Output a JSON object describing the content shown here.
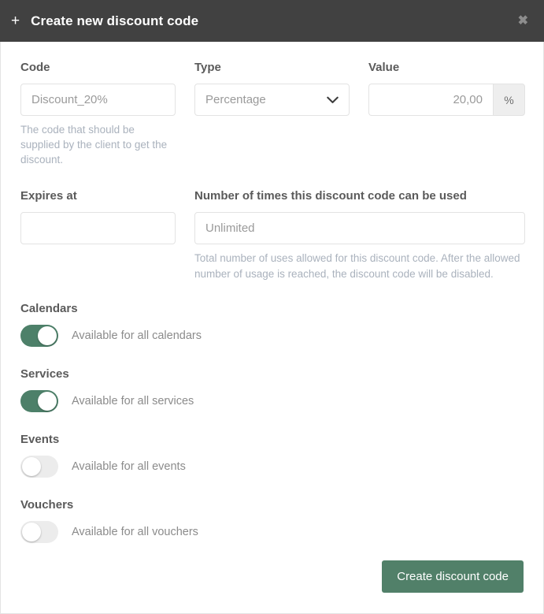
{
  "header": {
    "plus_icon": "plus-icon",
    "title": "Create new discount code",
    "close_icon": "✖"
  },
  "form": {
    "code": {
      "label": "Code",
      "value": "Discount_20%",
      "placeholder": "Discount_20%",
      "help": "The code that should be supplied by the client to get the discount."
    },
    "type": {
      "label": "Type",
      "value": "Percentage",
      "options": [
        "Percentage"
      ],
      "chevron_icon": "chevron-down-icon"
    },
    "value": {
      "label": "Value",
      "value": "20,00",
      "addon": "%"
    },
    "expires_at": {
      "label": "Expires at",
      "value": "",
      "placeholder": ""
    },
    "usage_limit": {
      "label": "Number of times this discount code can be used",
      "value": "",
      "placeholder": "Unlimited",
      "help": "Total number of uses allowed for this discount code. After the allowed number of usage is reached, the discount code will be disabled."
    }
  },
  "toggles": [
    {
      "label": "Calendars",
      "text": "Available for all calendars",
      "state": "on"
    },
    {
      "label": "Services",
      "text": "Available for all services",
      "state": "on"
    },
    {
      "label": "Events",
      "text": "Available for all events",
      "state": "off"
    },
    {
      "label": "Vouchers",
      "text": "Available for all vouchers",
      "state": "off"
    }
  ],
  "footer": {
    "submit_label": "Create discount code"
  },
  "colors": {
    "header_bg": "#414141",
    "accent_green": "#518069",
    "toggle_on": "#4d8069",
    "toggle_off": "#ececec",
    "help_text": "#aab2bd",
    "label_text": "#5a5a5a"
  }
}
